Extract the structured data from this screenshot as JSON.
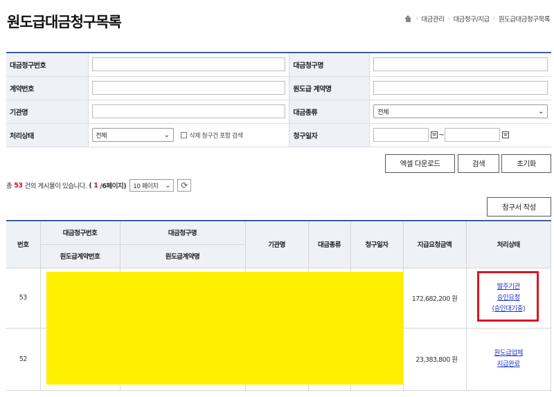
{
  "page": {
    "title": "원도급대금청구목록",
    "breadcrumb": [
      "대금관리",
      "대금청구/지급",
      "원도급대금청구목록"
    ]
  },
  "search": {
    "labels": {
      "claim_no": "대금청구번호",
      "claim_name": "대금청구명",
      "contract_no": "계약번호",
      "contract_name": "원도급 계약명",
      "org_name": "기관명",
      "pay_type": "대금종류",
      "status": "처리상태",
      "claim_date": "청구일자"
    },
    "values": {
      "claim_no": "",
      "claim_name": "",
      "contract_no": "",
      "contract_name": "",
      "org_name": "",
      "pay_type": "전체",
      "status": "전체",
      "date_from": "",
      "date_to": ""
    },
    "include_deleted_label": "삭제 청구건 포함 검색",
    "date_sep": "~"
  },
  "buttons": {
    "excel": "엑셀 다운로드",
    "search": "검색",
    "reset": "초기화",
    "write": "청구서 작성"
  },
  "summary": {
    "prefix": "총",
    "total": "53",
    "mid": "건의 게시물이 있습니다.",
    "paren_open": "(",
    "page": "1",
    "pages": "/6페이지)",
    "per_page": "10 페이지"
  },
  "table": {
    "headers": {
      "no": "번호",
      "claim_no": "대금청구번호",
      "claim_name": "대금청구명",
      "sub_contract_no": "원도급계약번호",
      "sub_contract_name": "원도급계약명",
      "org": "기관명",
      "type": "대금종류",
      "date": "청구일자",
      "amount": "지급요청금액",
      "status": "처리상태"
    },
    "rows": [
      {
        "no": "53",
        "amount": "172,682,200 원",
        "status": [
          "발주기관",
          "승인요청",
          "(승인대기중)"
        ]
      },
      {
        "no": "52",
        "amount": "23,383,800 원",
        "status": [
          "원도급업체",
          "지급완료"
        ]
      }
    ]
  },
  "colors": {
    "accent": "#3a5b9e",
    "highlight": "#ffef00",
    "annotation": "#d9161c",
    "link": "#1a35c4"
  }
}
